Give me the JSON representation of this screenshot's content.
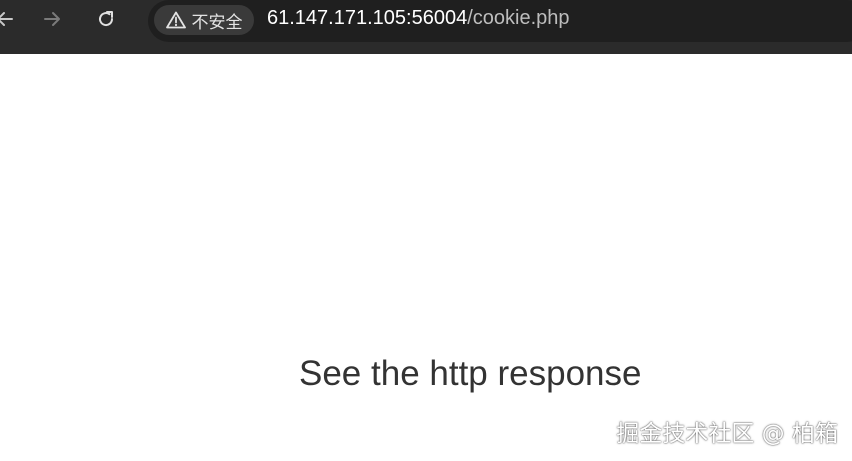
{
  "browser": {
    "back_icon": "arrow-left-icon",
    "forward_icon": "arrow-right-icon",
    "reload_icon": "reload-icon",
    "security": {
      "icon": "warning-triangle-icon",
      "label": "不安全"
    },
    "url": {
      "host": "61.147.171.105:56004",
      "path": "/cookie.php"
    }
  },
  "page": {
    "message": "See the http response"
  },
  "watermark": {
    "text": "掘金技术社区 @ 柏箱"
  },
  "colors": {
    "toolbar_bg": "#2b2b2b",
    "omnibox_bg": "#1f1f1f",
    "chip_bg": "#3a3a3a",
    "page_bg": "#ffffff",
    "message_text": "#333333"
  }
}
